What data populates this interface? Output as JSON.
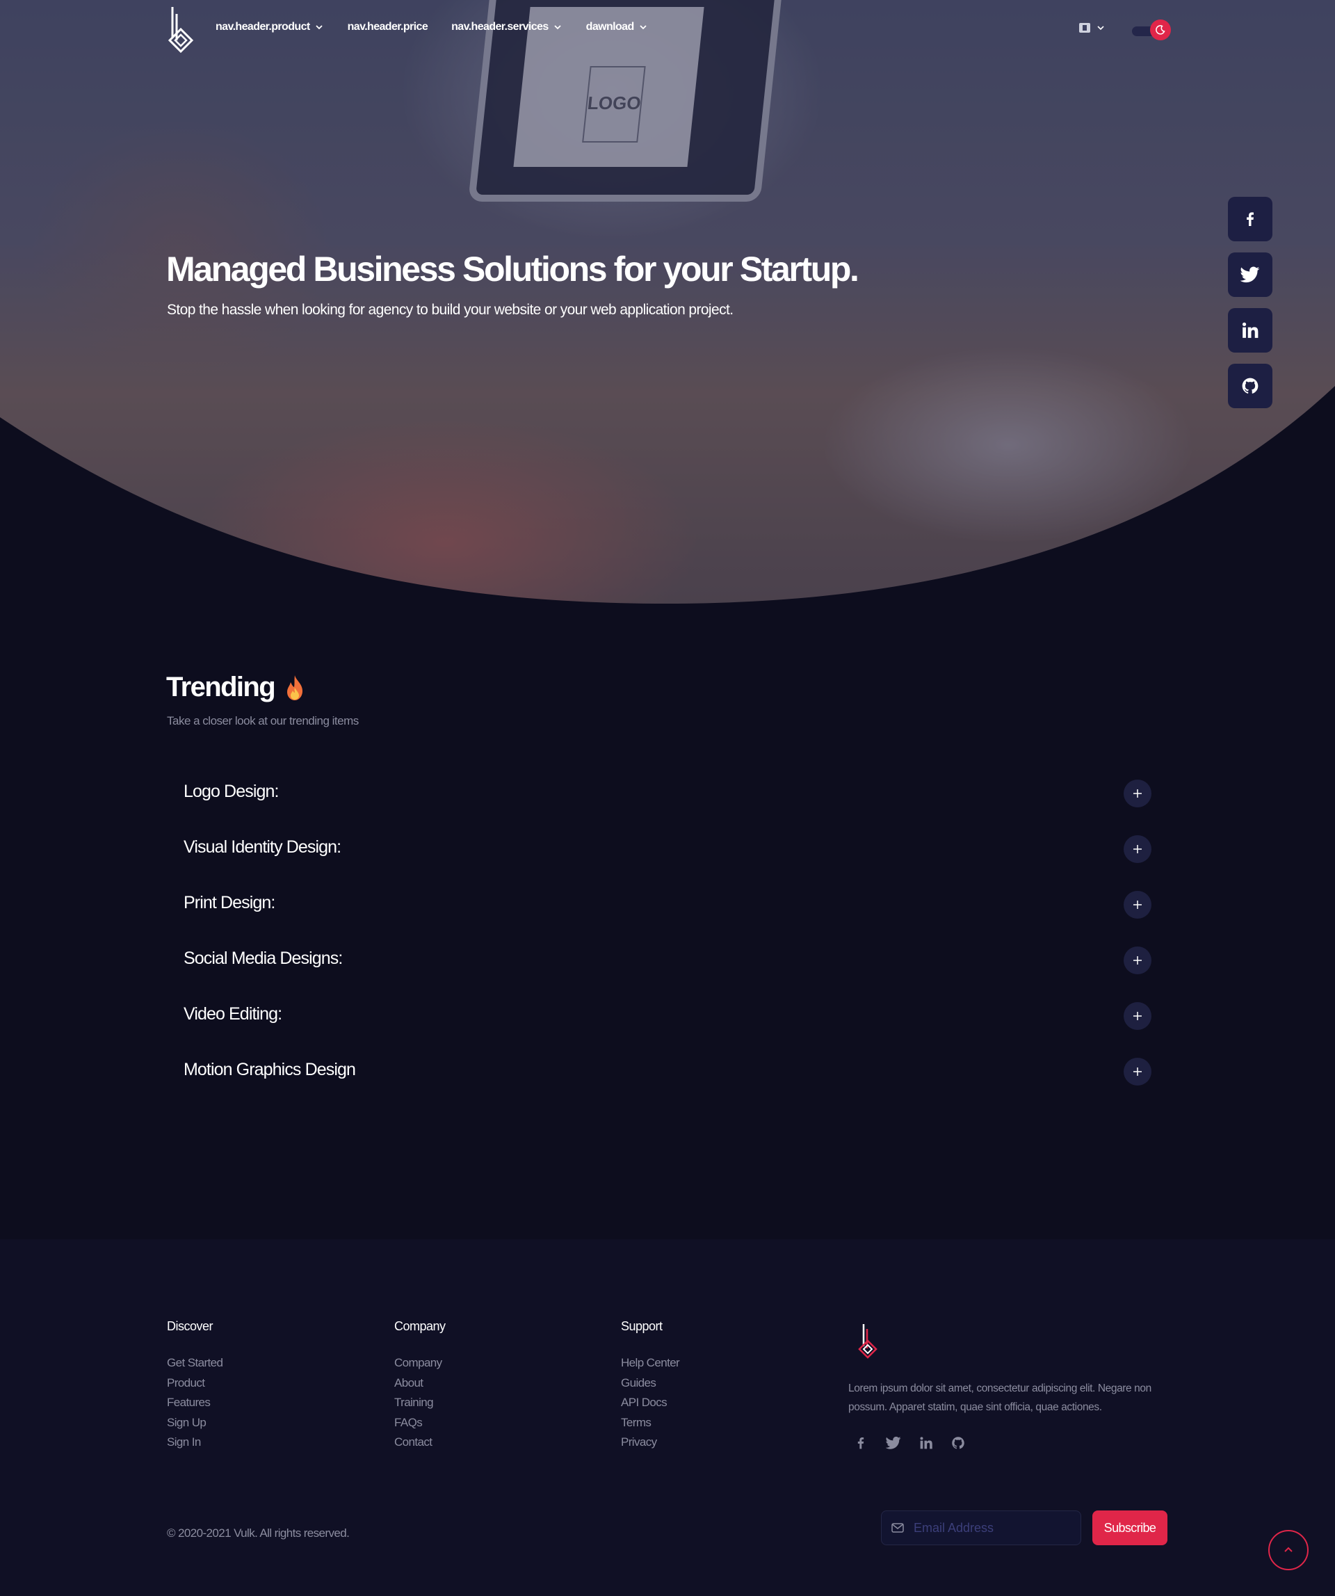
{
  "nav": {
    "items": [
      {
        "label": "nav.header.product",
        "has_dropdown": true
      },
      {
        "label": "nav.header.price",
        "has_dropdown": false
      },
      {
        "label": "nav.header.services",
        "has_dropdown": true
      },
      {
        "label": "dawnload",
        "has_dropdown": true
      }
    ],
    "language_icon": "flag-icon",
    "theme_toggle_icon": "moon-icon",
    "theme_dark": true
  },
  "hero": {
    "title": "Managed Business Solutions for your Startup.",
    "subtitle": "Stop the hassle when looking for agency to build your website or your web application project.",
    "monitor_text": "LOGO"
  },
  "social_sidebar": [
    "facebook-icon",
    "twitter-icon",
    "linkedin-icon",
    "github-icon"
  ],
  "trending": {
    "title": "Trending",
    "title_icon": "fire-icon",
    "subtitle": "Take a closer look at our trending items",
    "items": [
      "Logo Design:",
      "Visual Identity Design:",
      "Print Design:",
      "Social Media Designs:",
      "Video Editing:",
      "Motion Graphics Design"
    ]
  },
  "footer": {
    "columns": [
      {
        "heading": "Discover",
        "links": [
          "Get Started",
          "Product",
          "Features",
          "Sign Up",
          "Sign In"
        ]
      },
      {
        "heading": "Company",
        "links": [
          "Company",
          "About",
          "Training",
          "FAQs",
          "Contact"
        ]
      },
      {
        "heading": "Support",
        "links": [
          "Help Center",
          "Guides",
          "API Docs",
          "Terms",
          "Privacy"
        ]
      }
    ],
    "about_text": "Lorem ipsum dolor sit amet, consectetur adipiscing elit. Negare non possum. Apparet statim, quae sint officia, quae actiones.",
    "social": [
      "facebook-icon",
      "twitter-icon",
      "linkedin-icon",
      "github-icon"
    ],
    "copyright": "© 2020-2021 Vulk. All rights reserved.",
    "email_placeholder": "Email Address",
    "subscribe_label": "Subscribe"
  },
  "colors": {
    "accent": "#e02649",
    "background": "#0d0d1e",
    "footer_background": "#101025",
    "muted_text": "#8b8c9f",
    "social_button": "#1d1f43"
  }
}
